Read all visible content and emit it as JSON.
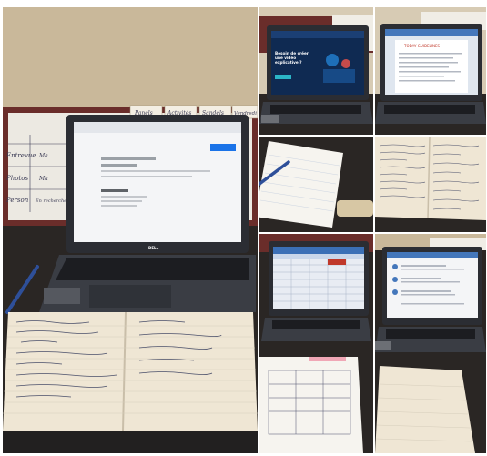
{
  "collage": {
    "panel_count": 7,
    "colors": {
      "background": "#ffffff",
      "wall": "#c9b89a",
      "desk": "#2a2624",
      "laptop": "#3a3d44",
      "notebook_paper": "#efe6d4",
      "screen_blue": "#3b6fb6",
      "screen_dark": "#0f2a52"
    }
  },
  "whiteboard": {
    "labels": [
      "Panels",
      "Activités",
      "Sandels",
      "Vendredi"
    ],
    "rows": [
      "Entrevue",
      "Photos",
      "Person"
    ],
    "cells": [
      "Ma",
      "Ma",
      "En recherche"
    ]
  },
  "laptop_screens": {
    "brand": "DELL",
    "landing_heading": "Besoin de créer une vidéo explicative ?",
    "doc_heading": "TODAY GUIDELINES"
  }
}
